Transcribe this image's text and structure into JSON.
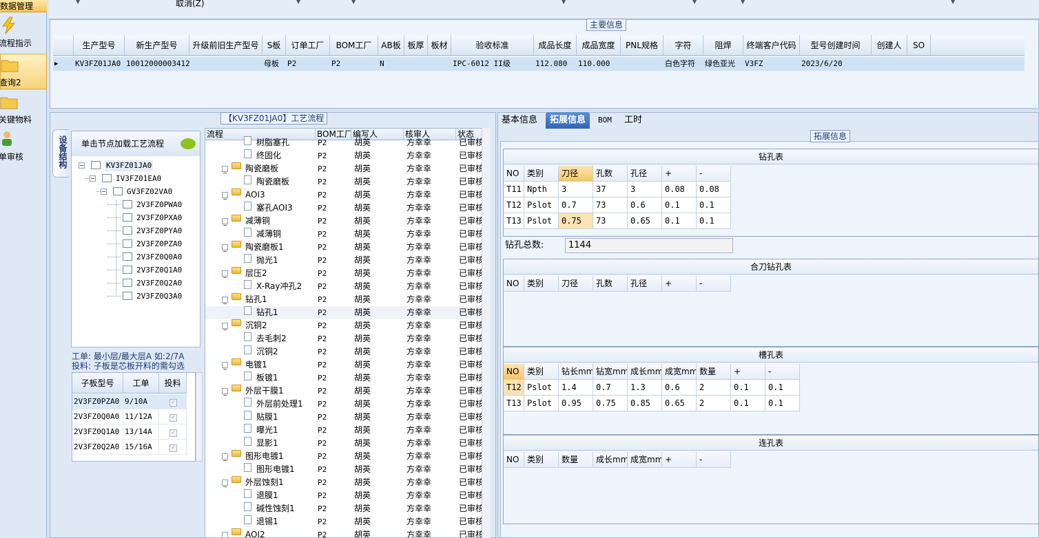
{
  "nav": {
    "header": "数据管理",
    "items": [
      {
        "label": "流程指示"
      },
      {
        "label": "查询2"
      },
      {
        "label": "关键物料"
      },
      {
        "label": "单审核"
      }
    ]
  },
  "topstrip": {
    "cancel_label": "取消(Z)"
  },
  "main_info": {
    "title": "主要信息",
    "columns": [
      "生产型号",
      "新生产型号",
      "升级前旧生产型号",
      "S板",
      "订单工厂",
      "BOM工厂",
      "AB板",
      "板厚",
      "板材",
      "验收标准",
      "成品长度",
      "成品宽度",
      "PNL规格",
      "字符",
      "阻焊",
      "终端客户代码",
      "型号创建时间",
      "创建人",
      "SO"
    ],
    "row": [
      "KV3FZ01JA0",
      "10012000003412",
      "",
      "母板",
      "P2",
      "P2",
      "N",
      "",
      "",
      "IPC-6012 II级",
      "112.080",
      "110.000",
      "",
      "白色字符",
      "绿色亚光",
      "V3FZ",
      "2023/6/20",
      "",
      ""
    ]
  },
  "process": {
    "title": "【KV3FZ01JA0】工艺流程",
    "vtab": "设备结构",
    "tree_header": "单击节点加载工艺流程",
    "tree": [
      {
        "label": "KV3FZ01JA0",
        "level": 0
      },
      {
        "label": "IV3FZ01EA0",
        "level": 1
      },
      {
        "label": "GV3FZ02VA0",
        "level": 2
      },
      {
        "label": "2V3FZ0PWA0",
        "level": 3
      },
      {
        "label": "2V3FZ0PXA0",
        "level": 3
      },
      {
        "label": "2V3FZ0PYA0",
        "level": 3
      },
      {
        "label": "2V3FZ0PZA0",
        "level": 3
      },
      {
        "label": "2V3FZ0Q0A0",
        "level": 3
      },
      {
        "label": "2V3FZ0Q1A0",
        "level": 3
      },
      {
        "label": "2V3FZ0Q2A0",
        "level": 3
      },
      {
        "label": "2V3FZ0Q3A0",
        "level": 3
      }
    ],
    "note_line1": "工单: 最小层/最大层A 如:2/7A",
    "note_line2": "投料: 子板是芯板开料的需勾选",
    "subgrid_columns": [
      "子板型号",
      "工单",
      "投料"
    ],
    "subgrid_rows": [
      [
        "2V3FZ0PZA0",
        "9/10A"
      ],
      [
        "2V3FZ0Q0A0",
        "11/12A"
      ],
      [
        "2V3FZ0Q1A0",
        "13/14A"
      ],
      [
        "2V3FZ0Q2A0",
        "15/16A"
      ]
    ],
    "flow_columns": [
      "流程",
      "BOM工厂",
      "编写人",
      "核审人",
      "状态"
    ],
    "flow_rows": [
      {
        "name": "树脂塞孔",
        "type": "leaf"
      },
      {
        "name": "终固化",
        "type": "leaf"
      },
      {
        "name": "陶瓷磨板",
        "type": "folder"
      },
      {
        "name": "陶瓷磨板",
        "type": "leaf"
      },
      {
        "name": "AOI3",
        "type": "folder"
      },
      {
        "name": "塞孔AOI3",
        "type": "leaf"
      },
      {
        "name": "减薄铜",
        "type": "folder"
      },
      {
        "name": "减薄铜",
        "type": "leaf"
      },
      {
        "name": "陶瓷磨板1",
        "type": "folder"
      },
      {
        "name": "抛光1",
        "type": "leaf"
      },
      {
        "name": "层压2",
        "type": "folder"
      },
      {
        "name": "X-Ray冲孔2",
        "type": "leaf"
      },
      {
        "name": "钻孔1",
        "type": "folder"
      },
      {
        "name": "钻孔1",
        "type": "leaf",
        "selected": true
      },
      {
        "name": "沉铜2",
        "type": "folder"
      },
      {
        "name": "去毛刺2",
        "type": "leaf"
      },
      {
        "name": "沉铜2",
        "type": "leaf"
      },
      {
        "name": "电镀1",
        "type": "folder"
      },
      {
        "name": "板镀1",
        "type": "leaf"
      },
      {
        "name": "外层干膜1",
        "type": "folder"
      },
      {
        "name": "外层前处理1",
        "type": "leaf"
      },
      {
        "name": "贴膜1",
        "type": "leaf"
      },
      {
        "name": "曝光1",
        "type": "leaf"
      },
      {
        "name": "显影1",
        "type": "leaf"
      },
      {
        "name": "图形电镀1",
        "type": "folder"
      },
      {
        "name": "图形电镀1",
        "type": "leaf"
      },
      {
        "name": "外层蚀刻1",
        "type": "folder"
      },
      {
        "name": "退膜1",
        "type": "leaf"
      },
      {
        "name": "碱性蚀刻1",
        "type": "leaf"
      },
      {
        "name": "退锡1",
        "type": "leaf"
      },
      {
        "name": "AOI2",
        "type": "folder"
      }
    ],
    "flow_bom": "P2",
    "flow_writer": "胡英",
    "flow_reviewer": "方幸幸",
    "flow_status": "已审核"
  },
  "right": {
    "tabs": [
      "基本信息",
      "拓展信息",
      "BOM",
      "工时"
    ],
    "active_tab": 1,
    "ext_title": "拓展信息",
    "drill": {
      "title": "钻孔表",
      "columns": [
        "NO",
        "类别",
        "刀径",
        "孔数",
        "孔径",
        "+",
        "-"
      ],
      "rows": [
        [
          "T11",
          "Npth",
          "3",
          "37",
          "3",
          "0.08",
          "0.08"
        ],
        [
          "T12",
          "Pslot",
          "0.7",
          "73",
          "0.6",
          "0.1",
          "0.1"
        ],
        [
          "T13",
          "Pslot",
          "0.75",
          "73",
          "0.65",
          "0.1",
          "0.1"
        ]
      ],
      "total_label": "钻孔总数:",
      "total_value": "1144"
    },
    "combo": {
      "title": "合刀钻孔表",
      "columns": [
        "NO",
        "类别",
        "刀径",
        "孔数",
        "孔径",
        "+",
        "-"
      ]
    },
    "slot": {
      "title": "槽孔表",
      "columns": [
        "NO",
        "类别",
        "钻长mm",
        "钻宽mm",
        "成长mm",
        "成宽mm",
        "数量",
        "+",
        "-"
      ],
      "rows": [
        [
          "T12",
          "Pslot",
          "1.4",
          "0.7",
          "1.3",
          "0.6",
          "2",
          "0.1",
          "0.1"
        ],
        [
          "T13",
          "Pslot",
          "0.95",
          "0.75",
          "0.85",
          "0.65",
          "2",
          "0.1",
          "0.1"
        ]
      ]
    },
    "link": {
      "title": "连孔表",
      "columns": [
        "NO",
        "类别",
        "数量",
        "成长mm",
        "成宽mm",
        "+",
        "-"
      ]
    }
  },
  "colors": {
    "accent": "#2f66b3",
    "selection": "#cfe3f7",
    "highlight": "#f7c46a"
  }
}
